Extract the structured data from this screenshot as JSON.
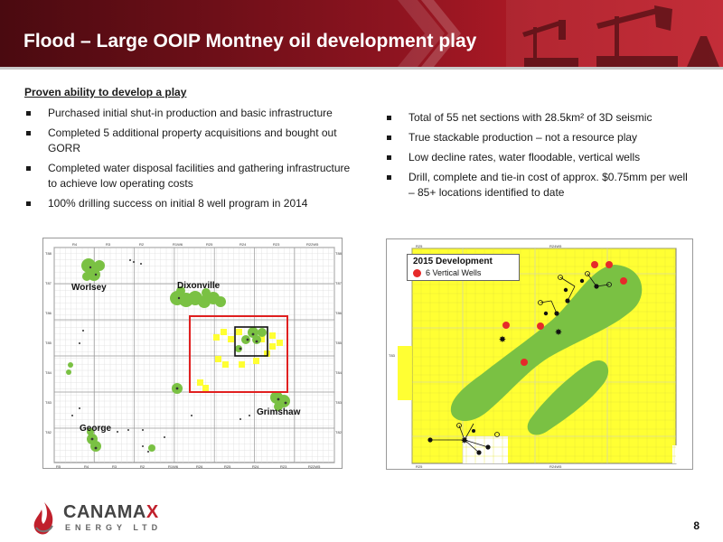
{
  "header": {
    "title": "Flood – Large OOIP Montney oil development play"
  },
  "left": {
    "heading": "Proven ability to develop a play",
    "bullets": [
      "Purchased initial shut-in production and basic infrastructure",
      "Completed 5 additional property acquisitions and bought out GORR",
      "Completed water disposal facilities and gathering infrastructure to achieve low operating costs",
      "100% drilling success on initial 8 well program in 2014"
    ]
  },
  "right": {
    "bullets": [
      "Total of 55 net sections with 28.5km² of 3D seismic",
      "True stackable production – not a resource play",
      "Low decline rates, water floodable, vertical wells",
      "Drill, complete and tie-in cost of approx. $0.75mm per well – 85+ locations identified to date"
    ]
  },
  "map_left": {
    "labels": {
      "worsley": "Worlsey",
      "dixonville": "Dixonville",
      "grimshaw": "Grimshaw",
      "george": "George"
    },
    "top_ticks": [
      "R4",
      "R3",
      "R2",
      "R1W6",
      "R25",
      "R24",
      "R23",
      "R22W5"
    ],
    "bottom_ticks": [
      "R5",
      "R4",
      "R3",
      "R2",
      "R1W6",
      "R26",
      "R25",
      "R24",
      "R23",
      "R22W5"
    ],
    "left_ticks": [
      "T88",
      "T87",
      "T86",
      "T85",
      "T84",
      "T83",
      "T82"
    ],
    "right_ticks": [
      "T88",
      "T87",
      "T86",
      "T85",
      "T84",
      "T83",
      "T82"
    ]
  },
  "map_right": {
    "legend_title": "2015 Development",
    "legend_item": "6 Vertical Wells",
    "tick_top_left": "R25",
    "tick_top_right": "R24W5",
    "tick_bottom_left": "R25",
    "tick_bottom_right": "R24W5",
    "tick_left": "T83"
  },
  "colors": {
    "header_dark": "#4a0a10",
    "header_bright": "#c0202c",
    "map_green": "#7ac143",
    "map_yellow": "#ffff33",
    "well_red": "#e62a2a",
    "brand_red": "#c0202c"
  },
  "logo": {
    "name_a": "CANAMA",
    "name_x": "X",
    "sub": "ENERGY LTD"
  },
  "page": {
    "number": "8"
  }
}
